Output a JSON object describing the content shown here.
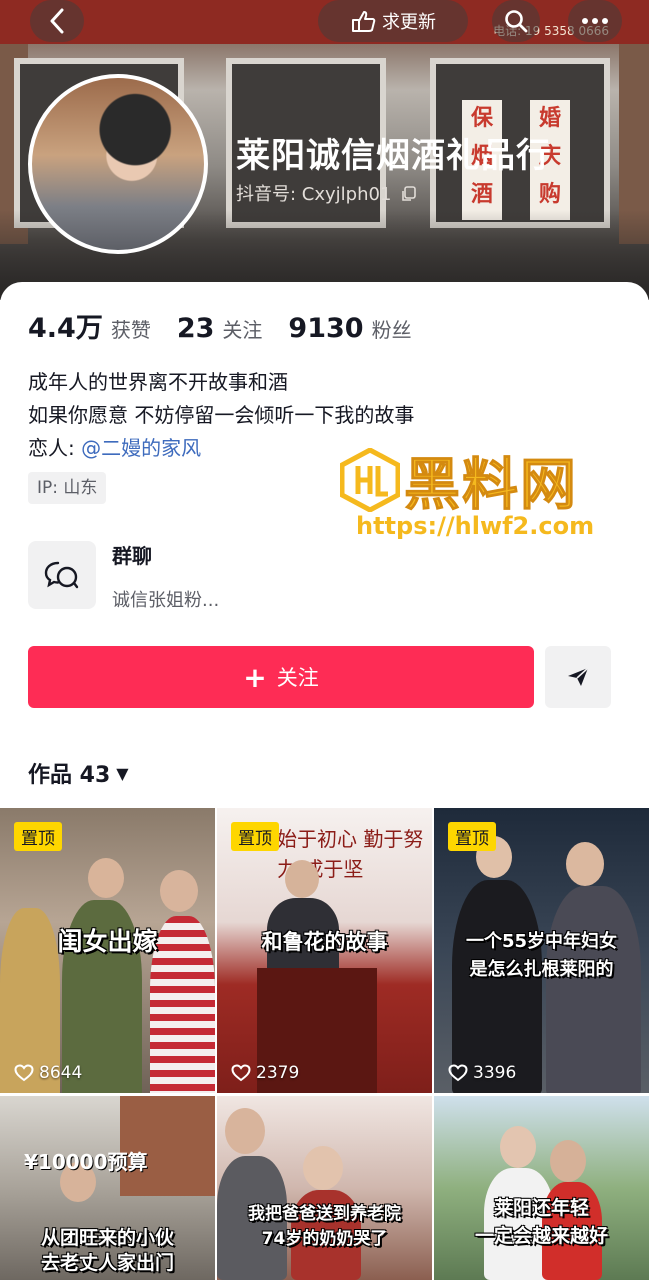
{
  "header": {
    "back_icon": "chevron-left-icon",
    "update_label": "求更新",
    "update_icon": "hand-point-icon",
    "search_icon": "search-icon",
    "more_icon": "more-dots-icon",
    "cover_phone": "电话: 19 5358 0666",
    "cover_poster_1": "保 烟 酒",
    "cover_poster_2": "婚 庆 购"
  },
  "profile": {
    "name": "莱阳诚信烟酒礼品行",
    "douyin_id": "抖音号: Cxyjlph01",
    "copy_icon": "copy-icon"
  },
  "stats": [
    {
      "value": "4.4万",
      "label": "获赞"
    },
    {
      "value": "23",
      "label": "关注"
    },
    {
      "value": "9130",
      "label": "粉丝"
    }
  ],
  "bio": {
    "line1": "成年人的世界离不开故事和酒",
    "line2": "如果你愿意 不妨停留一会倾听一下我的故事",
    "lover_prefix": "恋人: ",
    "lover_link": "@二嫚的家风"
  },
  "ip_tag": "IP: 山东",
  "watermark": {
    "text": "黑料网",
    "url": "https://hlwf2.com",
    "color": "#f5b91e"
  },
  "group_chat": {
    "title": "群聊",
    "subtitle": "诚信张姐粉...",
    "icon": "group-chat-icon"
  },
  "actions": {
    "follow_label": "关注",
    "follow_color": "#fe2c55",
    "share_icon": "send-arrow-icon"
  },
  "works": {
    "label": "作品 43",
    "caret_icon": "caret-down-icon"
  },
  "videos": [
    {
      "pinned": "置顶",
      "caption": "闺女出嫁",
      "likes": "8644"
    },
    {
      "pinned": "置顶",
      "caption": "和鲁花的故事",
      "likes": "2379",
      "backdrop_text": "始于初心 勤于努力 成于坚"
    },
    {
      "pinned": "置顶",
      "caption": "一个55岁中年妇女\n是怎么扎根莱阳的",
      "likes": "3396"
    },
    {
      "caption": "从团旺来的小伙\n去老丈人家出门",
      "overlay": "¥10000预算"
    },
    {
      "caption": "我把爸爸送到养老院\n74岁的奶奶哭了"
    },
    {
      "caption": "莱阳还年轻\n一定会越来越好"
    }
  ]
}
